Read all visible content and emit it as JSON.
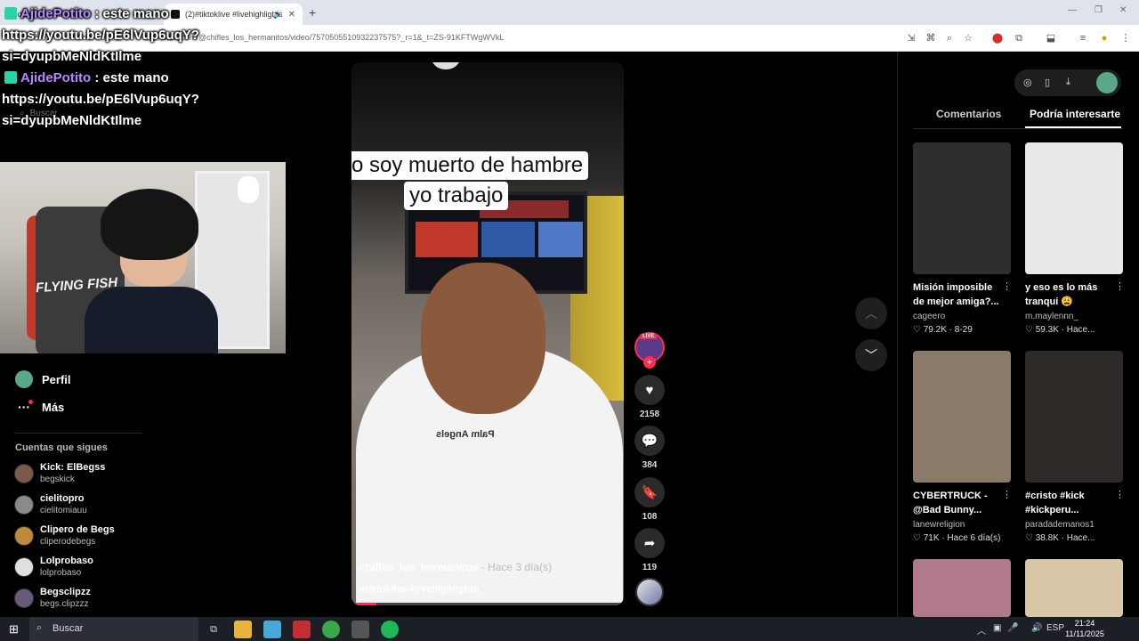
{
  "browser": {
    "tab1_title": "si=dyupbMeNldKtIlme",
    "tab2_title": "(2)#tiktoklive #livehighlights",
    "new_tab": "+",
    "url": "tiktok.com/@chifles_los_hermanitos/video/7570505510932237575?_r=1&_t=ZS-91KFTWgWVkL"
  },
  "chat": [
    {
      "user": "AjidePotito",
      "text": ": este mano"
    },
    {
      "text": "https://youtu.be/pE6lVup6uqY?"
    },
    {
      "text": "si=dyupbMeNldKtIlme"
    },
    {
      "user": "AjidePotito",
      "text": ": este mano"
    },
    {
      "text": "https://youtu.be/pE6lVup6uqY?"
    },
    {
      "text": "si=dyupbMeNldKtIlme"
    }
  ],
  "sidebar": {
    "search_placeholder": "Buscar",
    "nav": [
      {
        "label": "Perfil",
        "icon": "profile-avatar-icon"
      },
      {
        "label": "Más",
        "icon": "more-dots-icon"
      }
    ],
    "following_title": "Cuentas que sigues",
    "following": [
      {
        "name": "Kick: ElBegss",
        "handle": "begskick",
        "color": "#7a5a4a"
      },
      {
        "name": "cielitopro",
        "handle": "cielitomiauu",
        "color": "#8a8a8a"
      },
      {
        "name": "Clipero de Begs",
        "handle": "cliperodebegs",
        "color": "#c08a3a"
      },
      {
        "name": "Lolprobaso",
        "handle": "lolprobaso",
        "color": "#e0e0e0"
      },
      {
        "name": "Begsclipzz",
        "handle": "begs.clipzzz",
        "color": "#6a5a7a"
      }
    ]
  },
  "video": {
    "caption_line1": "o soy muerto de hambre",
    "caption_line2": "yo trabajo",
    "author": "chifles_los_hermanitos",
    "time": " · Hace 3 día(s)",
    "tags": "#tiktoklive #livehighlights",
    "shirt_text": "Palm Angels",
    "progress": 0.09
  },
  "actions": {
    "live_label": "LIVE",
    "likes": "2158",
    "comments": "384",
    "saves": "108",
    "shares": "119"
  },
  "webcam": {
    "shirt_text": "FLYING FISH"
  },
  "right_panel": {
    "tab_comments": "Comentarios",
    "tab_interest": "Podría interesarte",
    "cards": [
      {
        "title": "Misión imposible de mejor amiga?...",
        "author": "cageero",
        "stats": "♡ 79.2K · 8-29",
        "thumb": "#3a3a3a"
      },
      {
        "title": "y eso es lo más tranqui 😩",
        "author": "m.maylennn_",
        "stats": "♡ 59.3K · Hace...",
        "thumb": "#e8e8e8"
      },
      {
        "title": "CYBERTRUCK - @Bad Bunny...",
        "author": "lanewreligion",
        "stats": "♡ 71K · Hace 6 día(s)",
        "thumb": "#8a7a6a"
      },
      {
        "title": "#cristo #kick #kickperu...",
        "author": "paradademanos1",
        "stats": "♡ 38.8K · Hace...",
        "thumb": "#2e2a28"
      }
    ]
  },
  "taskbar": {
    "search": "Buscar",
    "lang": "ESP",
    "time": "21:24",
    "date": "11/11/2025"
  }
}
